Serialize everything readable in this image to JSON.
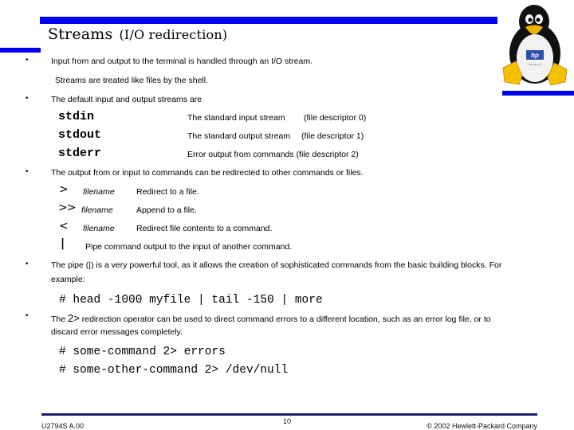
{
  "slide": {
    "title": "Streams",
    "subtitle": "(I/O redirection)",
    "bullets": [
      {
        "text": "Input from and output to the terminal is handled through an I/O stream.",
        "subtext": "Streams are treated like files by the shell."
      },
      {
        "text": "The default input and output streams are"
      },
      {
        "text": "The output from or input to commands can be redirected to other commands or files."
      },
      {
        "text": "The pipe (|) is a  very powerful tool, as it allows the creation of sophisticated commands from the basic building blocks. For",
        "text2": "example:"
      },
      {
        "text_before": "The ",
        "operator": "2>",
        "text_after": " redirection operator can be used to direct command errors to a different location, such as an error log file, or to",
        "text2": "discard error messages completely."
      }
    ],
    "streams": [
      {
        "name": "stdin",
        "description": "The standard input stream",
        "fd": "(file descriptor 0)"
      },
      {
        "name": "stdout",
        "description": "The standard output stream",
        "fd": "(file descriptor 1)"
      },
      {
        "name": "stderr",
        "description": "Error output from commands (file descriptor 2)",
        "fd": ""
      }
    ],
    "redirections": [
      {
        "symbol": ">",
        "arg": "filename",
        "description": "Redirect to a file."
      },
      {
        "symbol": ">>",
        "arg": "filename",
        "description": "Append to a file."
      },
      {
        "symbol": "<",
        "arg": "filename",
        "description": "Redirect file contents to a command."
      },
      {
        "symbol": "|",
        "arg": "",
        "description": "Pipe command output to the input of another command."
      }
    ],
    "examples": {
      "pipe": "# head -1000 myfile | tail -150 | more",
      "stderr1": "# some-command 2> errors",
      "stderr2": "# some-other-command 2> /dev/null"
    },
    "logo": {
      "icon": "tux-penguin-icon",
      "badge": "hp",
      "badge_caption": "invent"
    }
  },
  "footer": {
    "course_code": "U2794S A.00",
    "page_number": "10",
    "copyright": "© 2002 Hewlett-Packard Company"
  },
  "colors": {
    "accent_bar": "#0000ee",
    "footer_line": "#1a1a6e"
  }
}
